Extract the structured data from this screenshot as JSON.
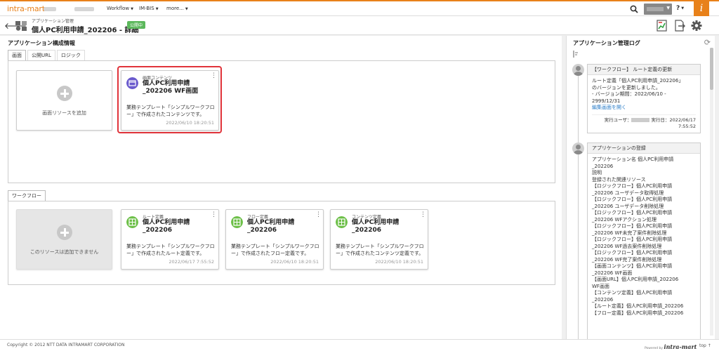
{
  "topbar": {
    "logo": "intra-mart",
    "nav": [
      {
        "label": "Workflow"
      },
      {
        "label": "IM-BIS"
      },
      {
        "label": "more..."
      }
    ],
    "help": "?"
  },
  "header": {
    "breadcrumb": "アプリケーション管理",
    "title": "個人PC利用申請_202206 - 詳細",
    "status": "公開中"
  },
  "main": {
    "section_title": "アプリケーション構成情報",
    "tabs": [
      {
        "label": "画面"
      },
      {
        "label": "公開URL"
      },
      {
        "label": "ロジック"
      }
    ],
    "screen_add_label": "画面リソースを追加",
    "screen_card": {
      "category": "画面コンテンツ",
      "title": "個人PC利用申請_202206 WF画面",
      "desc": "業務テンプレート「シンプルワークフロー」で作成されたコンテンツです。",
      "date": "2022/06/10 18:20:51"
    },
    "workflow_tab": "ワークフロー",
    "workflow_disabled_label": "このリソースは追加できません",
    "workflow_cards": [
      {
        "category": "ルート定義",
        "title": "個人PC利用申請_202206",
        "desc": "業務テンプレート「シンプルワークフロー」で作成されたルート定義です。",
        "date": "2022/06/17 7:55:52"
      },
      {
        "category": "フロー定義",
        "title": "個人PC利用申請_202206",
        "desc": "業務テンプレート「シンプルワークフロー」で作成されたフロー定義です。",
        "date": "2022/06/10 18:20:51"
      },
      {
        "category": "コンテンツ定義",
        "title": "個人PC利用申請_202206",
        "desc": "業務テンプレート「シンプルワークフロー」で作成されたコンテンツ定義です。",
        "date": "2022/06/10 18:20:51"
      }
    ]
  },
  "sidebar": {
    "title": "アプリケーション管理ログ",
    "log1": {
      "head": "【ワークフロー】 ルート定義の更新",
      "l1": "ルート定義「個人PC利用申請_202206」",
      "l2": "のバージョンを更新しました。",
      "l3": "- バージョン期間：2022/06/10 -",
      "l4": "2999/12/31",
      "link": "編集画面を開く",
      "user_label": "実行ユーザ：",
      "date_label": "実行日：2022/06/17",
      "time": "7:55:52"
    },
    "log2": {
      "head": "アプリケーションの登録",
      "lines": [
        "アプリケーション名 個人PC利用申請",
        "_202206",
        "説明",
        "登録された関連リソース",
        "【ロジックフロー】個人PC利用申請",
        "_202206 ユーザデータ取得処理",
        "【ロジックフロー】個人PC利用申請",
        "_202206 ユーザデータ削除処理",
        "【ロジックフロー】個人PC利用申請",
        "_202206 WFアクション処理",
        "【ロジックフロー】個人PC利用申請",
        "_202206 WF未完了案件削除処理",
        "【ロジックフロー】個人PC利用申請",
        "_202206 WF過去案件削除処理",
        "【ロジックフロー】個人PC利用申請",
        "_202206 WF完了案件削除処理",
        "【画面コンテンツ】個人PC利用申請",
        "_202206 WF画面",
        "【画面URL】個人PC利用申請_202206",
        "WF画面",
        "【コンテンツ定義】個人PC利用申請",
        "_202206",
        "【ルート定義】個人PC利用申請_202206",
        "【フロー定義】個人PC利用申請_202206"
      ]
    }
  },
  "footer": {
    "copyright": "Copyright © 2012 NTT DATA INTRAMART CORPORATION",
    "powered": "Powered by",
    "brand": "intra-mart",
    "top": "top ↑"
  },
  "colors": {
    "accent": "#e8811a",
    "status_green": "#5cb85c",
    "screen_icon": "#6a5acd",
    "workflow_icon": "#6cbf47",
    "highlight": "#e0333a",
    "link": "#2a7cc7"
  }
}
